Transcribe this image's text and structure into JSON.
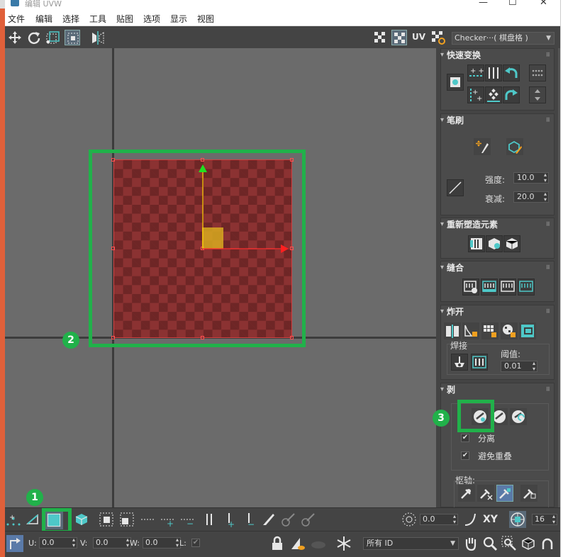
{
  "window": {
    "title": "编辑 UVW",
    "minimize": "—",
    "maximize": "☐",
    "close": "✕"
  },
  "menu": [
    "文件",
    "编辑",
    "选择",
    "工具",
    "贴图",
    "选项",
    "显示",
    "视图"
  ],
  "toolbar": {
    "uv_label": "UV",
    "checker_dropdown": "Checker···( 棋盘格 )"
  },
  "panel": {
    "quick_transform": {
      "title": "快速变换"
    },
    "brush": {
      "title": "笔刷",
      "strength_label": "强度:",
      "strength_value": "10.0",
      "falloff_label": "衰减:",
      "falloff_value": "20.0"
    },
    "reshape": {
      "title": "重新塑造元素"
    },
    "stitch": {
      "title": "缝合"
    },
    "explode": {
      "title": "炸开",
      "weld_label": "焊接",
      "threshold_label": "阈值:",
      "threshold_value": "0.01"
    },
    "peel": {
      "title": "剥",
      "detach_label": "分离",
      "avoid_overlap_label": "避免重叠",
      "pivot_label": "枢轴:"
    }
  },
  "bottom": {
    "angle_value": "0.0",
    "xy_label": "XY",
    "grid_value": "16",
    "u_label": "U:",
    "u_value": "0.0",
    "v_label": "V:",
    "v_value": "0.0",
    "w_label": "W:",
    "w_value": "0.0",
    "l_label": "L:",
    "id_dropdown": "所有 ID"
  },
  "annotations": {
    "badge1": "1",
    "badge2": "2",
    "badge3": "3"
  },
  "colors": {
    "highlight": "#21b14a",
    "accent_teal": "#4ec8c8",
    "uv_fill": "#8b3232"
  }
}
